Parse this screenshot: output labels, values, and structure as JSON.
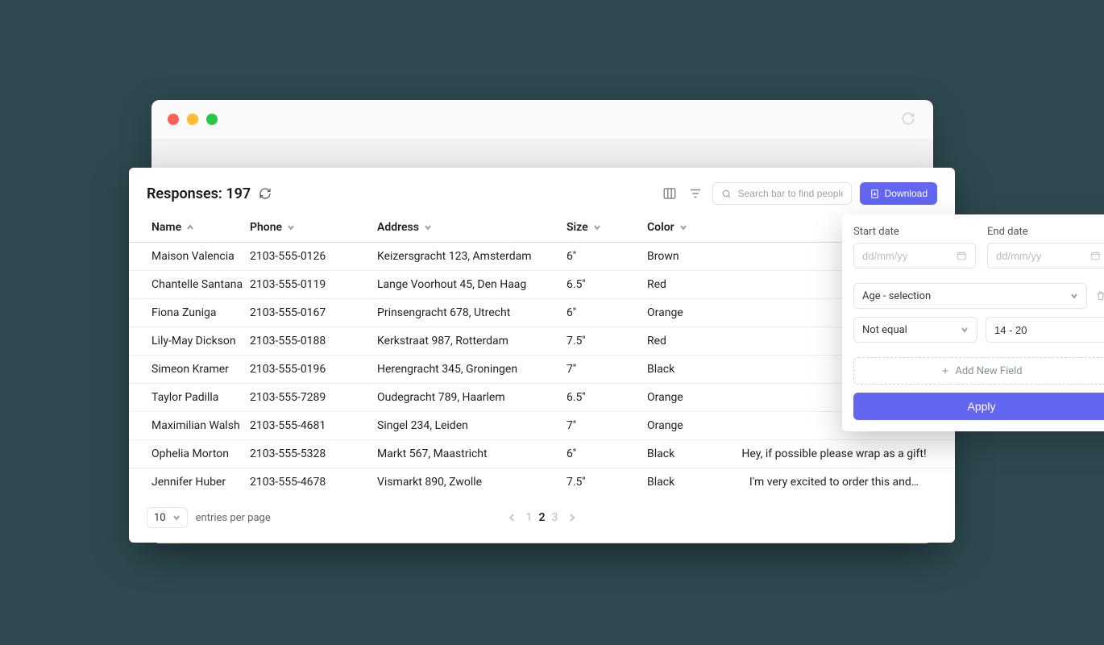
{
  "header": {
    "title_prefix": "Responses:",
    "count": "197"
  },
  "search": {
    "placeholder": "Search bar to find people"
  },
  "download_label": "Download",
  "columns": {
    "name": "Name",
    "phone": "Phone",
    "address": "Address",
    "size": "Size",
    "color": "Color"
  },
  "rows": [
    {
      "name": "Maison Valencia",
      "phone": "2103-555-0126",
      "address": "Keizersgracht 123, Amsterdam",
      "size": "6''",
      "color": "Brown",
      "notes": ""
    },
    {
      "name": "Chantelle Santana",
      "phone": "2103-555-0119",
      "address": "Lange Voorhout 45, Den Haag",
      "size": "6.5''",
      "color": "Red",
      "notes": ""
    },
    {
      "name": "Fiona Zuniga",
      "phone": "2103-555-0167",
      "address": "Prinsengracht 678, Utrecht",
      "size": "6''",
      "color": "Orange",
      "notes": ""
    },
    {
      "name": "Lily-May Dickson",
      "phone": "2103-555-0188",
      "address": "Kerkstraat 987, Rotterdam",
      "size": "7.5''",
      "color": "Red",
      "notes": ""
    },
    {
      "name": "Simeon Kramer",
      "phone": "2103-555-0196",
      "address": "Herengracht 345, Groningen",
      "size": "7''",
      "color": "Black",
      "notes": ""
    },
    {
      "name": "Taylor Padilla",
      "phone": "2103-555-7289",
      "address": "Oudegracht 789, Haarlem",
      "size": "6.5''",
      "color": "Orange",
      "notes": ""
    },
    {
      "name": "Maximilian Walsh",
      "phone": "2103-555-4681",
      "address": "Singel 234, Leiden",
      "size": "7''",
      "color": "Orange",
      "notes": ""
    },
    {
      "name": "Ophelia Morton",
      "phone": "2103-555-5328",
      "address": "Markt 567, Maastricht",
      "size": "6''",
      "color": "Black",
      "notes": "Hey, if possible please wrap as a gift!"
    },
    {
      "name": "Jennifer Huber",
      "phone": "2103-555-4678",
      "address": "Vismarkt 890, Zwolle",
      "size": "7.5''",
      "color": "Black",
      "notes": "I'm very excited to order this and…"
    }
  ],
  "footer": {
    "page_size": "10",
    "page_size_label": "entries per page",
    "pages": [
      "1",
      "2",
      "3"
    ],
    "active_page": "2"
  },
  "filter": {
    "start_label": "Start date",
    "end_label": "End date",
    "date_placeholder": "dd/mm/yy",
    "field_select": "Age - selection",
    "operator": "Not equal",
    "value": "14 - 20",
    "add_field": "Add New Field",
    "apply": "Apply"
  }
}
